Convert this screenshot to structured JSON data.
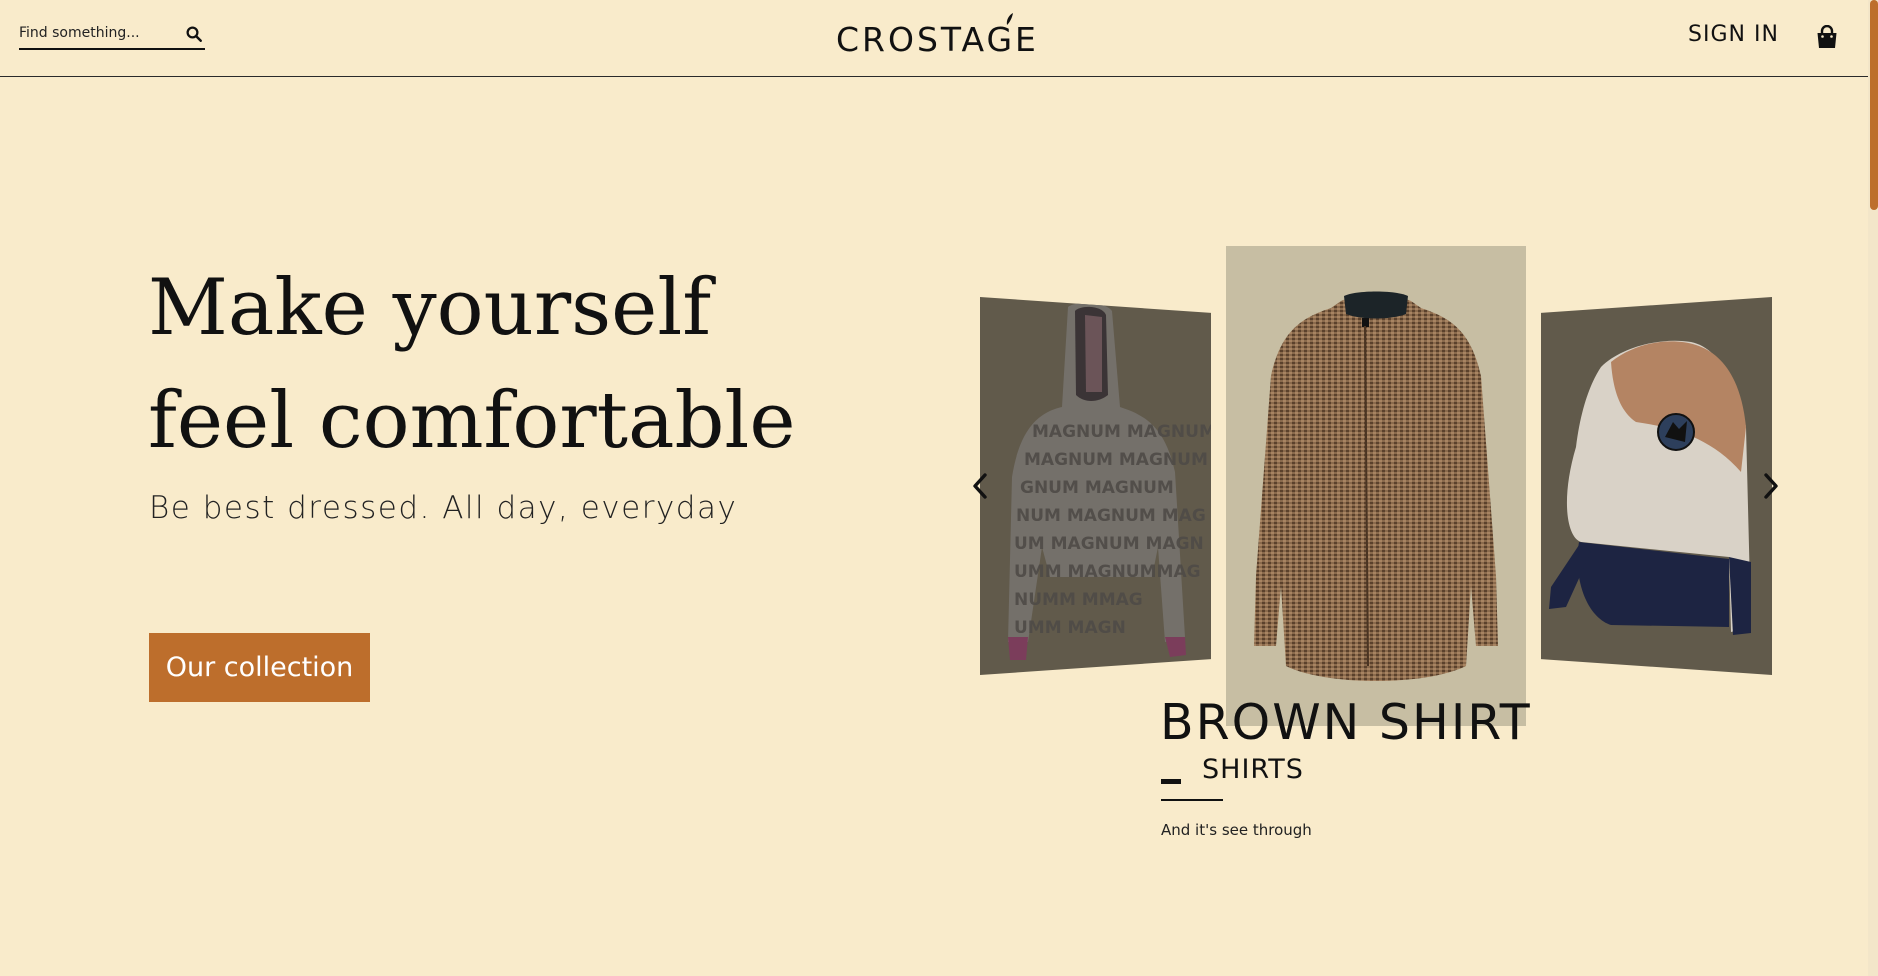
{
  "header": {
    "search_placeholder": "Find something...",
    "logo": "CROSTAGE",
    "signin_label": "SIGN IN"
  },
  "hero": {
    "title": "Make yourself feel comfortable",
    "subtitle": "Be best dressed. All day, everyday",
    "cta_label": "Our collection"
  },
  "carousel": {
    "current": {
      "name": "BROWN SHIRT",
      "category": "SHIRTS",
      "description": "And it's see through"
    }
  },
  "colors": {
    "background": "#f9ebcb",
    "accent": "#bd6e2c",
    "text": "#111111"
  },
  "icons": [
    "search-icon",
    "shopping-bag-icon",
    "chevron-left-icon",
    "chevron-right-icon"
  ]
}
